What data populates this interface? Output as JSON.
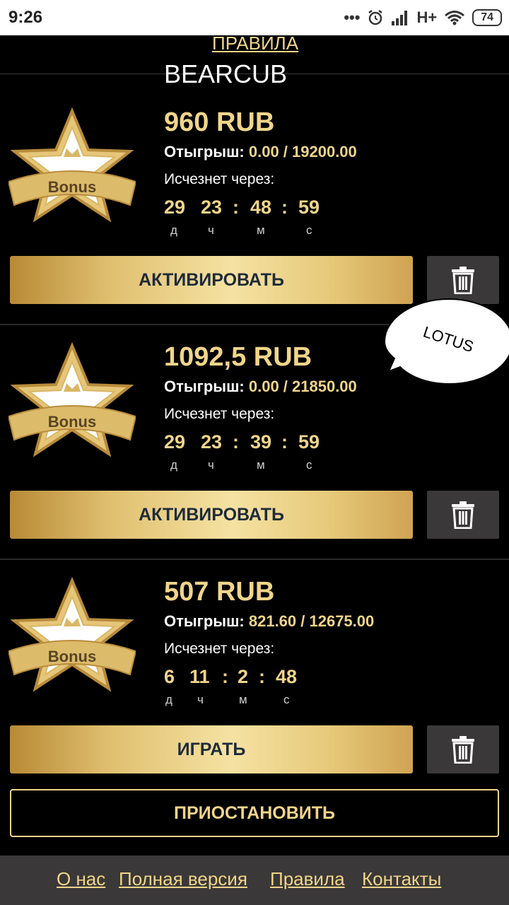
{
  "status_bar": {
    "time": "9:26",
    "network": "H+",
    "battery": "74",
    "icons": [
      "more-dots-icon",
      "alarm-icon",
      "signal-icon",
      "wifi-icon",
      "battery-icon"
    ]
  },
  "header": {
    "rules_link": "ПРАВИЛА",
    "brand": "BEARCUB"
  },
  "bonuses": [
    {
      "amount": "960 RUB",
      "wager_label": "Отыгрыш:",
      "wager_value": "0.00 / 19200.00",
      "expires_label": "Исчезнет через:",
      "timer": {
        "d": "29",
        "h": "23",
        "m": "48",
        "s": "59"
      },
      "action_label": "АКТИВИРОВАТЬ"
    },
    {
      "amount": "1092,5 RUB",
      "wager_label": "Отыгрыш:",
      "wager_value": "0.00 / 21850.00",
      "expires_label": "Исчезнет через:",
      "timer": {
        "d": "29",
        "h": "23",
        "m": "39",
        "s": "59"
      },
      "action_label": "АКТИВИРОВАТЬ"
    },
    {
      "amount": "507 RUB",
      "wager_label": "Отыгрыш:",
      "wager_value": "821.60 / 12675.00",
      "expires_label": "Исчезнет через:",
      "timer": {
        "d": "6",
        "h": "11",
        "m": "2",
        "s": "48"
      },
      "action_label": "ИГРАТЬ"
    }
  ],
  "units": {
    "d": "д",
    "h": "ч",
    "m": "м",
    "s": "с"
  },
  "colon": ":",
  "star_badge_text": "Bonus",
  "bubble_text": "LOTUS",
  "pause_label": "ПРИОСТАНОВИТЬ",
  "footer": {
    "about": "О нас",
    "full_version": "Полная версия",
    "rules": "Правила",
    "contacts": "Контакты"
  },
  "colors": {
    "gold": "#f0d58a",
    "button_text": "#1f2b3a",
    "trash_bg": "#3a3838"
  }
}
